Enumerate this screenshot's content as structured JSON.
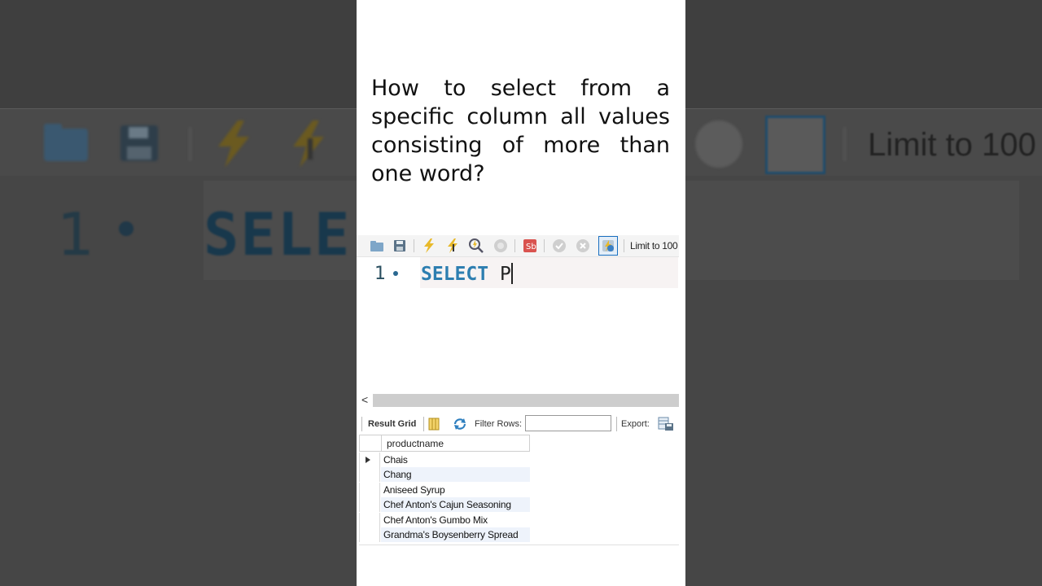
{
  "question": "How to select from a specific column all values consisting of more than one word?",
  "toolbar": {
    "limit_label": "Limit to 100",
    "icons": [
      "folder-icon",
      "save-icon",
      "execute-icon",
      "execute-current-icon",
      "explain-icon",
      "stop-icon",
      "toggle-error-icon",
      "commit-icon",
      "rollback-icon",
      "autocommit-icon"
    ]
  },
  "editor": {
    "line_number": "1",
    "keyword": "SELECT",
    "text": "P"
  },
  "background": {
    "line_number": "1",
    "keyword": "SELE",
    "limit_label": "Limit to 100"
  },
  "results": {
    "tab_label": "Result Grid",
    "filter_label": "Filter Rows:",
    "filter_value": "",
    "export_label": "Export:",
    "column": "productname",
    "rows": [
      "Chais",
      "Chang",
      "Aniseed Syrup",
      "Chef Anton's Cajun Seasoning",
      "Chef Anton's Gumbo Mix",
      "Grandma's Boysenberry Spread"
    ]
  },
  "colors": {
    "keyword": "#2d7eb0",
    "autocommit_border": "#1a6fc0"
  }
}
